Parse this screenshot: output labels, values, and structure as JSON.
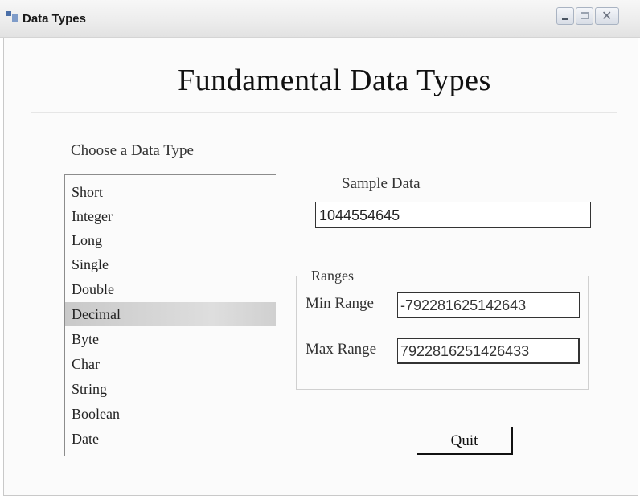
{
  "window": {
    "title": "Data Types"
  },
  "heading": "Fundamental Data Types",
  "type_list": {
    "label": "Choose a Data Type",
    "items": [
      "Short",
      "Integer",
      "Long",
      "Single",
      "Double",
      "Decimal",
      "Byte",
      "Char",
      "String",
      "Boolean",
      "Date"
    ],
    "selected": "Decimal"
  },
  "sample": {
    "label": "Sample Data",
    "value": "1044554645"
  },
  "ranges": {
    "legend": "Ranges",
    "min_label": "Min Range",
    "min_value": "-792281625142643",
    "max_label": "Max Range",
    "max_value": "7922816251426433"
  },
  "quit_label": "Quit",
  "colors": {
    "selection": "#d0d0d0",
    "text": "#222222"
  }
}
